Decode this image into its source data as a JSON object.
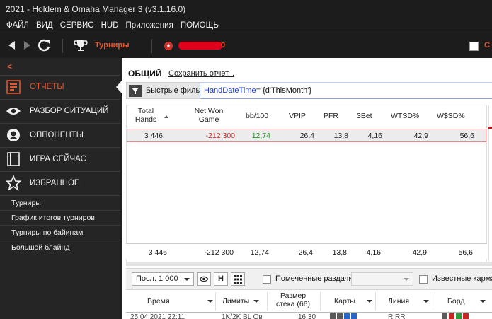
{
  "window": {
    "title": "2021 - Holdem & Omaha Manager 3 (v3.1.16.0)"
  },
  "menu": [
    "ФАЙЛ",
    "ВИД",
    "СЕРВИС",
    "HUD",
    "Приложения",
    "ПОМОЩЬ"
  ],
  "toolbar": {
    "tournaments_label": "Турниры",
    "redacted_suffix": "0",
    "right_label": "С"
  },
  "sidebar": {
    "collapse_glyph": "<",
    "items": [
      {
        "label": "ОТЧЕТЫ",
        "icon": "reports-icon",
        "active": true
      },
      {
        "label": "РАЗБОР СИТУАЦИЙ",
        "icon": "eye-icon"
      },
      {
        "label": "ОППОНЕНТЫ",
        "icon": "user-icon"
      },
      {
        "label": "ИГРА СЕЙЧАС",
        "icon": "play-now-icon"
      },
      {
        "label": "ИЗБРАННОЕ",
        "icon": "star-icon"
      }
    ],
    "subitems": [
      "Турниры",
      "График итогов турниров",
      "Турниры по байинам",
      "Большой блайнд"
    ]
  },
  "main": {
    "title": "ОБЩИЙ",
    "save_link": "Сохранить отчет...",
    "filter_label": "Быстрые фильт",
    "filter_keyword": "HandDateTime",
    "filter_value": "= {d'ThisMonth'}"
  },
  "grid": {
    "headers": [
      {
        "line1": "Total",
        "line2": "Hands"
      },
      {
        "line1": "Net Won",
        "line2": "Game"
      },
      {
        "line1": "bb/100",
        "line2": ""
      },
      {
        "line1": "VPIP",
        "line2": ""
      },
      {
        "line1": "PFR",
        "line2": ""
      },
      {
        "line1": "3Bet",
        "line2": ""
      },
      {
        "line1": "WTSD%",
        "line2": ""
      },
      {
        "line1": "W$SD%",
        "line2": ""
      }
    ],
    "row": [
      "3 446",
      "-212 300",
      "12,74",
      "26,4",
      "13,8",
      "4,16",
      "42,9",
      "56,6"
    ],
    "totals": [
      "3 446",
      "-212 300",
      "12,74",
      "26,4",
      "13,8",
      "4,16",
      "42,9",
      "56,6"
    ]
  },
  "lower": {
    "select_value": "Посл. 1 000",
    "h_button": "H",
    "marked_label": "Помеченные раздачи",
    "known_cards_label": "Известные карманы",
    "headers": {
      "time": "Время",
      "limits": "Лимиты",
      "stack_line1": "Размер",
      "stack_line2": "стека (66)",
      "cards": "Карты",
      "line": "Линия",
      "board": "Борд"
    },
    "partial_row": {
      "time": "25.04.2021 22:11",
      "limits": "1K/2K BL Ов",
      "stack": "16,30",
      "line": "R,RR"
    }
  },
  "colors": {
    "accent": "#e5572d",
    "negative": "#d11a1a",
    "positive": "#1d8f1d",
    "dark_bg": "#1c1c1c",
    "sidebar_bg": "#252525"
  }
}
